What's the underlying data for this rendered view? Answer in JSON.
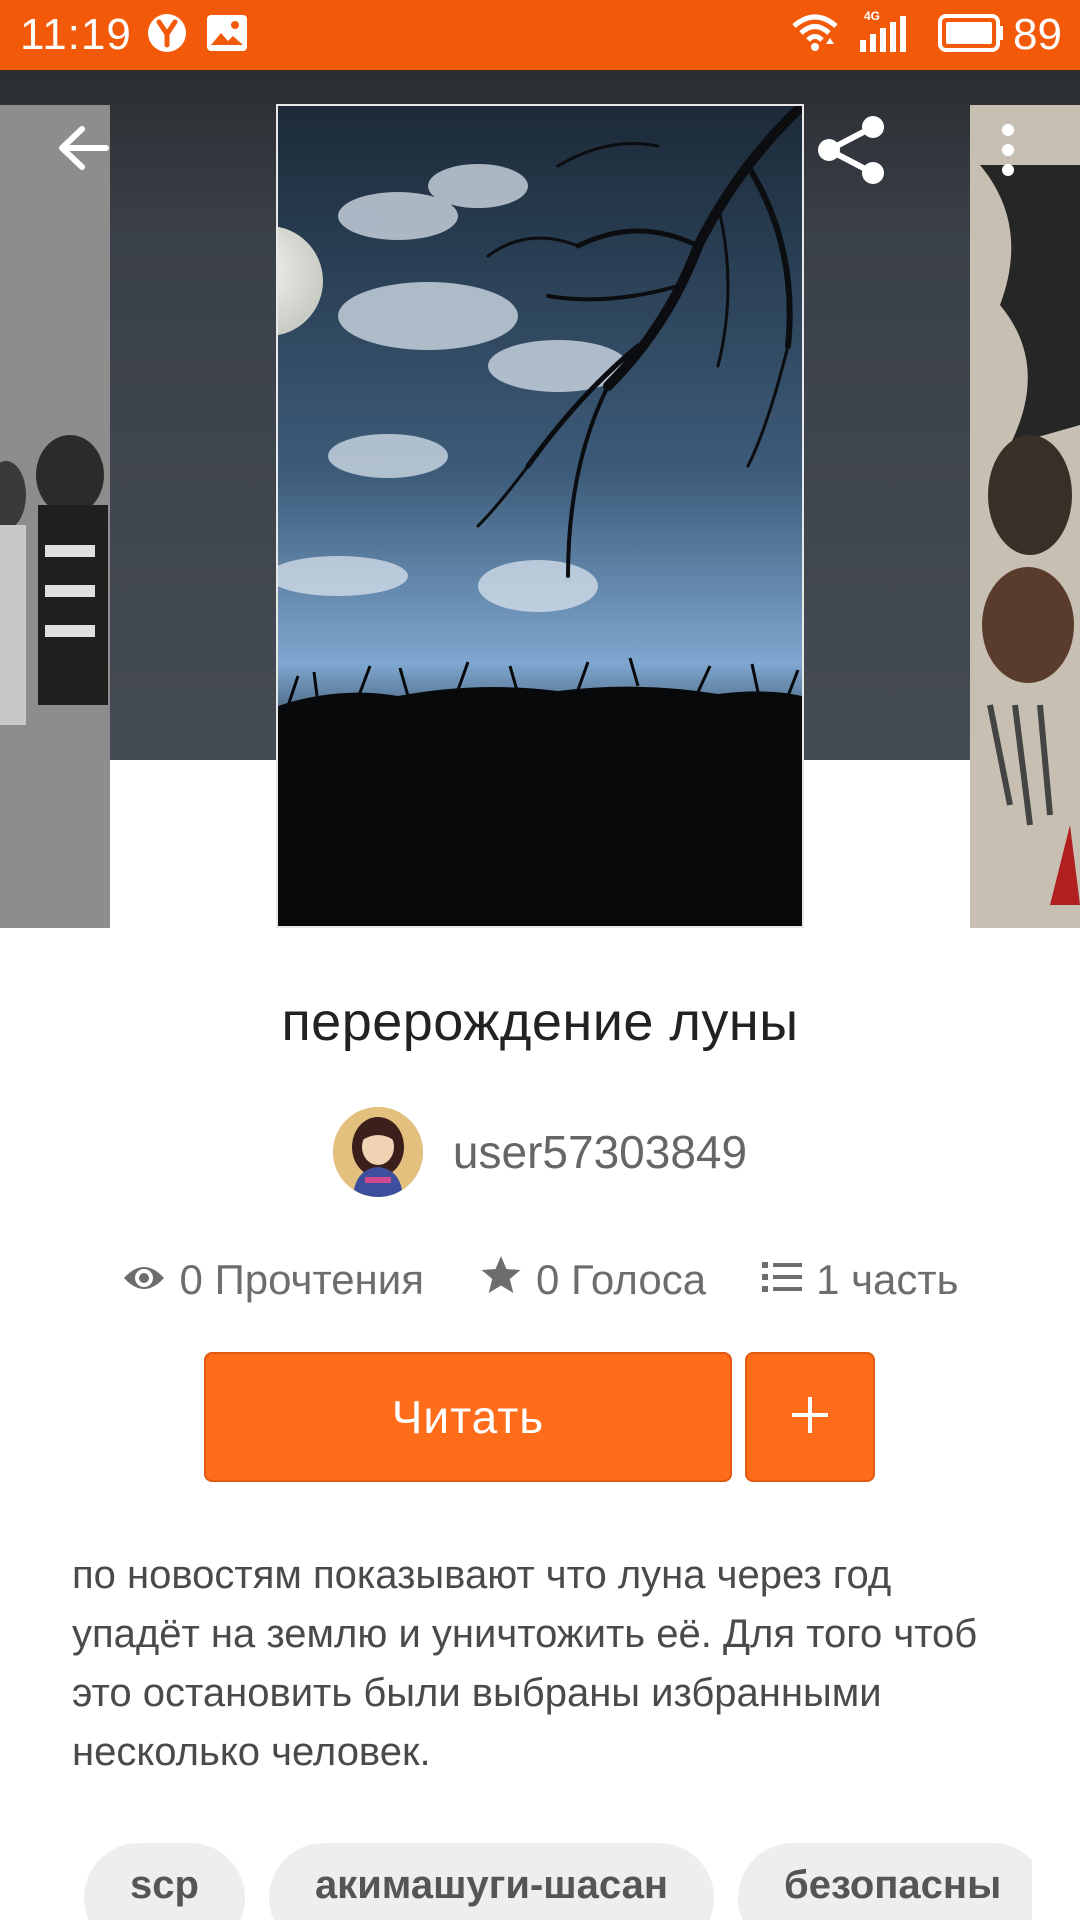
{
  "status_bar": {
    "time": "11:19",
    "network": "4G",
    "battery": "89"
  },
  "story": {
    "title": "перерождение луны",
    "author": "user57303849",
    "stats": {
      "reads": "0 Прочтения",
      "votes": "0 Голоса",
      "parts": "1 часть"
    },
    "read_button": "Читать",
    "add_button": "+",
    "description": "по новостям показывают что луна через год упадёт на землю и уничтожить её. Для того чтоб это остановить были выбраны избранными несколько человек.",
    "tags": [
      "scp",
      "акимашуги-шасан",
      "безопасны"
    ]
  },
  "icons": {
    "back": "arrow-left-icon",
    "share": "share-icon",
    "more": "more-vertical-icon",
    "views": "eye-icon",
    "votes": "star-icon",
    "parts": "list-icon"
  },
  "colors": {
    "accent": "#ff6c1a",
    "status_bar": "#f25a0a"
  }
}
